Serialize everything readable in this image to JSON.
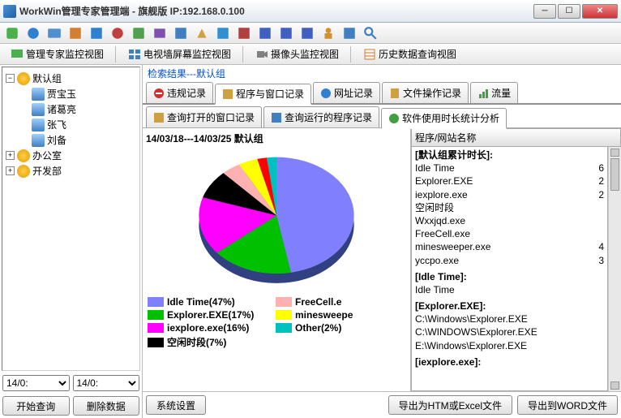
{
  "window": {
    "title": "WorkWin管理专家管理端 - 旗舰版 IP:192.168.0.100"
  },
  "viewtabs": {
    "v1": "管理专家监控视图",
    "v2": "电视墙屏幕监控视图",
    "v3": "摄像头监控视图",
    "v4": "历史数据查询视图"
  },
  "tree": {
    "root": "默认组",
    "items": [
      "贾宝玉",
      "诸葛亮",
      "张飞",
      "刘备"
    ],
    "groups": [
      "办公室",
      "开发部"
    ]
  },
  "dates": {
    "from": "14/0:",
    "to": "14/0:"
  },
  "leftbtns": {
    "start": "开始查询",
    "del": "删除数据"
  },
  "search_result": "检索结果---默认组",
  "records_tabs": {
    "t1": "违规记录",
    "t2": "程序与窗口记录",
    "t3": "网址记录",
    "t4": "文件操作记录",
    "t5": "流量"
  },
  "sub_tabs": {
    "s1": "查询打开的窗口记录",
    "s2": "查询运行的程序记录",
    "s3": "软件使用时长统计分析"
  },
  "chart_header": "14/03/18---14/03/25  默认组",
  "chart_data": {
    "type": "pie",
    "title": "14/03/18---14/03/25  默认组",
    "series": [
      {
        "name": "Idle Time",
        "percent": 47,
        "color": "#8080ff"
      },
      {
        "name": "Explorer.EXE",
        "percent": 17,
        "color": "#00c000"
      },
      {
        "name": "iexplore.exe",
        "percent": 16,
        "color": "#ff00ff"
      },
      {
        "name": "空闲时段",
        "percent": 7,
        "color": "#000000"
      },
      {
        "name": "FreeCell.exe",
        "percent": 5,
        "color": "#ffb0b0"
      },
      {
        "name": "minesweeper.exe",
        "percent": 4,
        "color": "#ffff00"
      },
      {
        "name": "yccpo.exe",
        "percent": 2,
        "color": "#ff0000"
      },
      {
        "name": "Other",
        "percent": 2,
        "color": "#00c0c0"
      }
    ],
    "legend_col1": [
      "Idle Time(47%)",
      "Explorer.EXE(17%)",
      "iexplore.exe(16%)",
      "空闲时段(7%)"
    ],
    "legend_col2": [
      "FreeCell.e",
      "minesweepe",
      "Other(2%)"
    ]
  },
  "list": {
    "header": "程序/网站名称",
    "sections": [
      {
        "title": "[默认组累计时长]:",
        "rows": [
          {
            "n": "Idle Time",
            "v": "6"
          },
          {
            "n": "Explorer.EXE",
            "v": "2"
          },
          {
            "n": "iexplore.exe",
            "v": "2"
          },
          {
            "n": "空闲时段",
            "v": ""
          },
          {
            "n": "Wxxjqd.exe",
            "v": ""
          },
          {
            "n": "FreeCell.exe",
            "v": ""
          },
          {
            "n": "minesweeper.exe",
            "v": "4"
          },
          {
            "n": "yccpo.exe",
            "v": "3"
          }
        ]
      },
      {
        "title": "[Idle Time]:",
        "rows": [
          {
            "n": "Idle Time",
            "v": ""
          }
        ]
      },
      {
        "title": "[Explorer.EXE]:",
        "rows": [
          {
            "n": "C:\\Windows\\Explorer.EXE",
            "v": ""
          },
          {
            "n": "C:\\WINDOWS\\Explorer.EXE",
            "v": ""
          },
          {
            "n": "E:\\Windows\\Explorer.EXE",
            "v": ""
          }
        ]
      },
      {
        "title": "[iexplore.exe]:",
        "rows": []
      }
    ]
  },
  "bottom": {
    "sys": "系统设置",
    "exp1": "导出为HTM或Excel文件",
    "exp2": "导出到WORD文件"
  }
}
